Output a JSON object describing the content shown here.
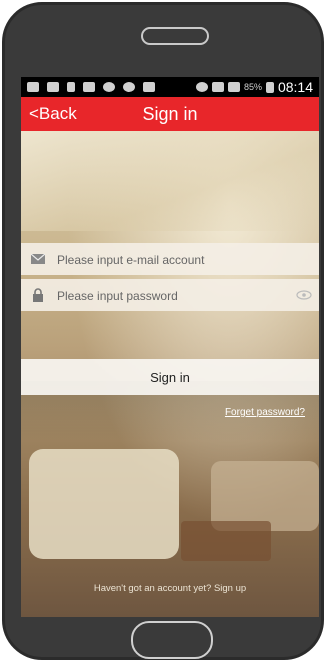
{
  "statusbar": {
    "battery_percent": "85%",
    "time": "08:14"
  },
  "appbar": {
    "back_label": "<Back",
    "title": "Sign in"
  },
  "form": {
    "email_placeholder": "Please input e-mail account",
    "password_placeholder": "Please input password",
    "signin_label": "Sign in",
    "forget_label": "Forget password?",
    "signup_label": "Haven't got an account yet? Sign up"
  },
  "colors": {
    "appbar_bg": "#e8262a",
    "phone_body": "#3a3a3a"
  }
}
